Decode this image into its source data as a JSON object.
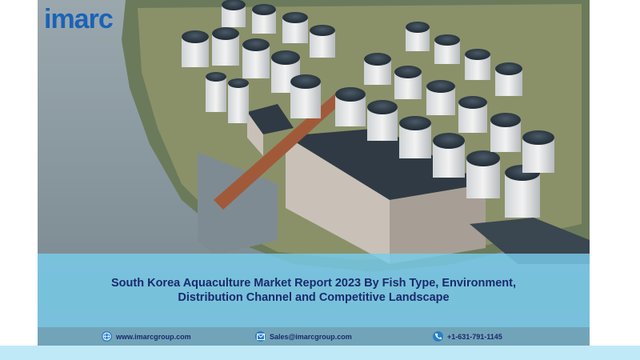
{
  "brand": {
    "logo_text": "imarc",
    "accent": "#1a63b8"
  },
  "title": {
    "line1": "South Korea Aquaculture Market Report 2023 By Fish Type, Environment,",
    "line2": "Distribution Channel and Competitive Landscape"
  },
  "contacts": {
    "website": {
      "icon": "globe-icon",
      "text": "www.imarcgroup.com"
    },
    "email": {
      "icon": "email-icon",
      "text": "Sales@imarcgroup.com"
    },
    "phone": {
      "icon": "phone-icon",
      "text": "+1-631-791-1145"
    }
  },
  "colors": {
    "title_panel": "#78cdeb",
    "title_text": "#1a2a6c",
    "bottom_strip": "#bfe9f6"
  }
}
